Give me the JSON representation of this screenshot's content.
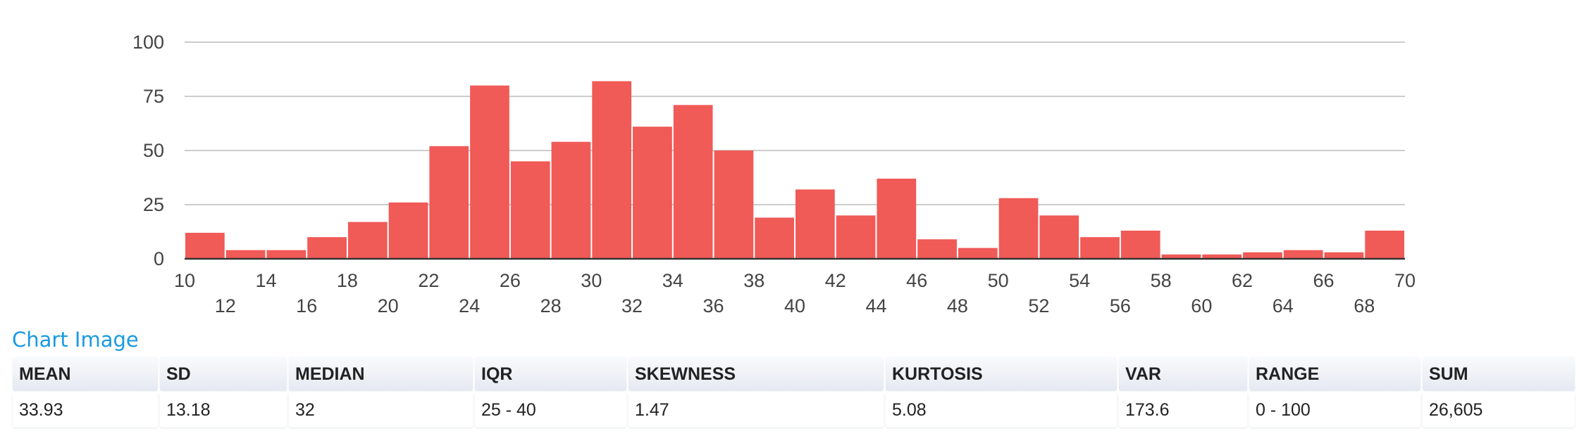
{
  "chart_data": {
    "type": "bar",
    "subtype": "histogram",
    "title": "",
    "xlabel": "",
    "ylabel": "",
    "xlim": [
      10,
      70
    ],
    "ylim": [
      0,
      100
    ],
    "grid": true,
    "legend": "none",
    "bar_color": "#f05a57",
    "bin_width": 2,
    "bins": [
      10,
      12,
      14,
      16,
      18,
      20,
      22,
      24,
      26,
      28,
      30,
      32,
      34,
      36,
      38,
      40,
      42,
      44,
      46,
      48,
      50,
      52,
      54,
      56,
      58,
      60,
      62,
      64,
      66,
      68
    ],
    "values": [
      12,
      4,
      4,
      10,
      17,
      26,
      52,
      80,
      45,
      54,
      82,
      61,
      71,
      50,
      19,
      32,
      20,
      37,
      9,
      5,
      28,
      20,
      10,
      13,
      2,
      2,
      3,
      4,
      3,
      13
    ],
    "y_ticks": [
      "0",
      "25",
      "50",
      "75",
      "100"
    ],
    "x_ticks_top": [
      "10",
      "14",
      "18",
      "22",
      "26",
      "30",
      "34",
      "38",
      "42",
      "46",
      "50",
      "54",
      "58",
      "62",
      "66",
      "70"
    ],
    "x_ticks_bottom": [
      "12",
      "16",
      "20",
      "24",
      "28",
      "32",
      "36",
      "40",
      "44",
      "48",
      "52",
      "56",
      "60",
      "64",
      "68"
    ]
  },
  "link": {
    "label": "Chart Image"
  },
  "stats": [
    {
      "header": "MEAN",
      "value": "33.93"
    },
    {
      "header": "SD",
      "value": "13.18"
    },
    {
      "header": "MEDIAN",
      "value": "32"
    },
    {
      "header": "IQR",
      "value": "25 - 40"
    },
    {
      "header": "SKEWNESS",
      "value": "1.47"
    },
    {
      "header": "KURTOSIS",
      "value": "5.08"
    },
    {
      "header": "VAR",
      "value": "173.6"
    },
    {
      "header": "RANGE",
      "value": "0 - 100"
    },
    {
      "header": "SUM",
      "value": "26,605"
    }
  ]
}
